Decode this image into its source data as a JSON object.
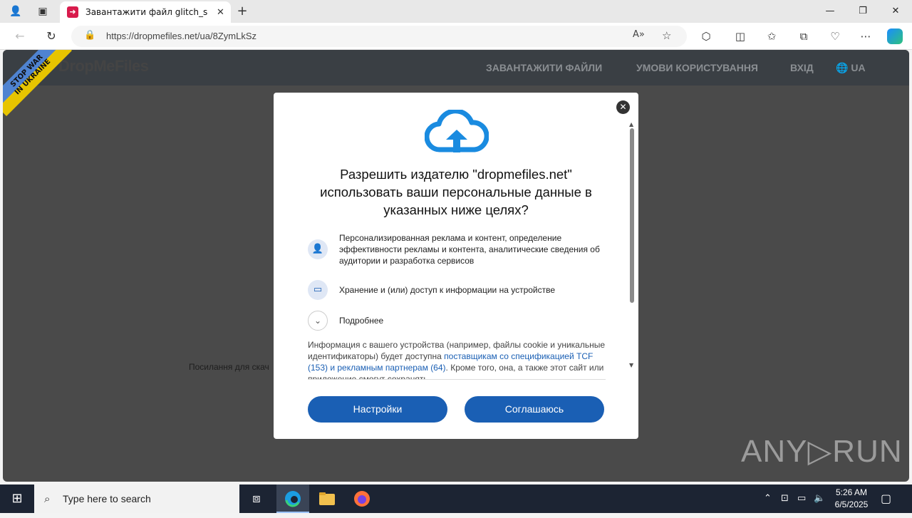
{
  "browser": {
    "tab_title": "Завантажити файл glitch_screar",
    "tab_close": "✕",
    "new_tab": "+",
    "url": "https://dropmefiles.net/ua/8ZymLkSz",
    "window_controls": {
      "minimize": "—",
      "maximize": "❐",
      "close": "✕"
    }
  },
  "site": {
    "logo_a": "DropMe",
    "logo_b": "Files",
    "ribbon_line1": "STOP WAR",
    "ribbon_line2": "IN UKRAINE",
    "nav": [
      "ЗАВАНТАЖИТИ ФАЙЛИ",
      "УМОВИ КОРИСТУВАННЯ",
      "ВХІД",
      "UA"
    ],
    "page_text": "Посилання для скач"
  },
  "dialog": {
    "close": "✕",
    "title": "Разрешить издателю \"dropmefiles.net\" использовать ваши персональные данные в указанных ниже целях?",
    "purposes": [
      {
        "icon": "person-icon",
        "text": "Персонализированная реклама и контент, определение эффективности рекламы и контента, аналитические сведения об аудитории и разработка сервисов"
      },
      {
        "icon": "devices-icon",
        "text": "Хранение и (или) доступ к информации на устройстве"
      },
      {
        "icon": "chevron-down-icon",
        "text": "Подробнее"
      }
    ],
    "info_before": "Информация с вашего устройства (например, файлы cookie и уникальные идентификаторы) будет доступна ",
    "info_link": "поставщикам со спецификацией TCF (153) и рекламным партнерам (64)",
    "info_after": ". Кроме того, она, а также этот сайт или приложение смогут сохранять",
    "settings_button": "Настройки",
    "agree_button": "Соглашаюсь"
  },
  "watermark": "ANY▷RUN",
  "taskbar": {
    "search_placeholder": "Type here to search",
    "time": "5:26 AM",
    "date": "6/5/2025"
  },
  "colors": {
    "accent": "#1a5fb4",
    "header": "#3a3f44",
    "overlay": "#4a4a4a"
  }
}
